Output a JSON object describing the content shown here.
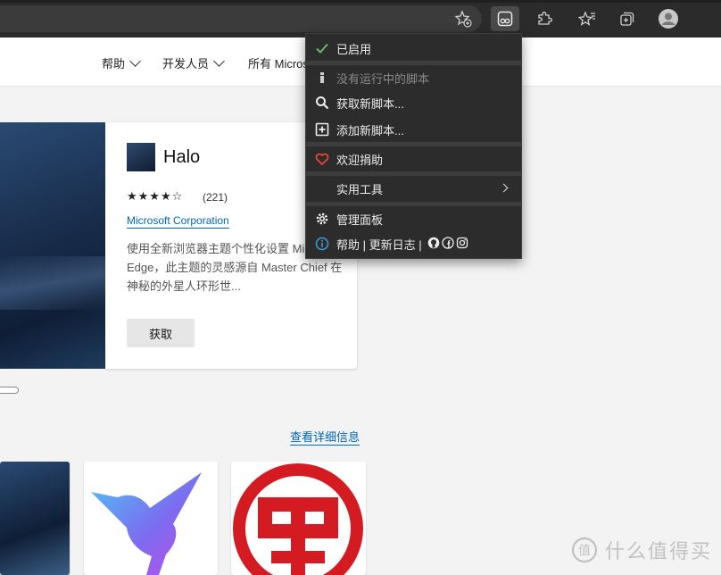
{
  "toolbar": {
    "buttons": [
      {
        "name": "favorites-add-icon"
      },
      {
        "name": "tampermonkey-extension-icon",
        "active": true
      },
      {
        "name": "extensions-icon"
      },
      {
        "name": "favorites-icon"
      },
      {
        "name": "collections-icon"
      },
      {
        "name": "profile-avatar-icon"
      }
    ]
  },
  "nav": {
    "items": [
      "帮助",
      "开发人员",
      "所有 Micros"
    ]
  },
  "hero": {
    "title": "Halo",
    "stars": "★★★★☆",
    "rating_count": "(221)",
    "publisher": "Microsoft Corporation",
    "description": "使用全新浏览器主题个性化设置 Microsoft Edge，此主题的灵感源自 Master Chief 在神秘的外星人环形世...",
    "get_label": "获取"
  },
  "more_link": "查看详细信息",
  "menu": {
    "enabled_label": "已启用",
    "no_scripts_label": "没有运行中的脚本",
    "get_scripts_label": "获取新脚本...",
    "add_script_label": "添加新脚本...",
    "donate_label": "欢迎捐助",
    "utilities_label": "实用工具",
    "dashboard_label": "管理面板",
    "help_label": "帮助 | 更新日志 |"
  },
  "watermark": {
    "text": "什么值得买",
    "logo_char": "值"
  },
  "colors": {
    "accent_link": "#0067b8",
    "menu_bg": "#2c2c2c",
    "check_green": "#6db56d",
    "heart_red": "#e0473a",
    "info_blue": "#3a9ad9"
  }
}
